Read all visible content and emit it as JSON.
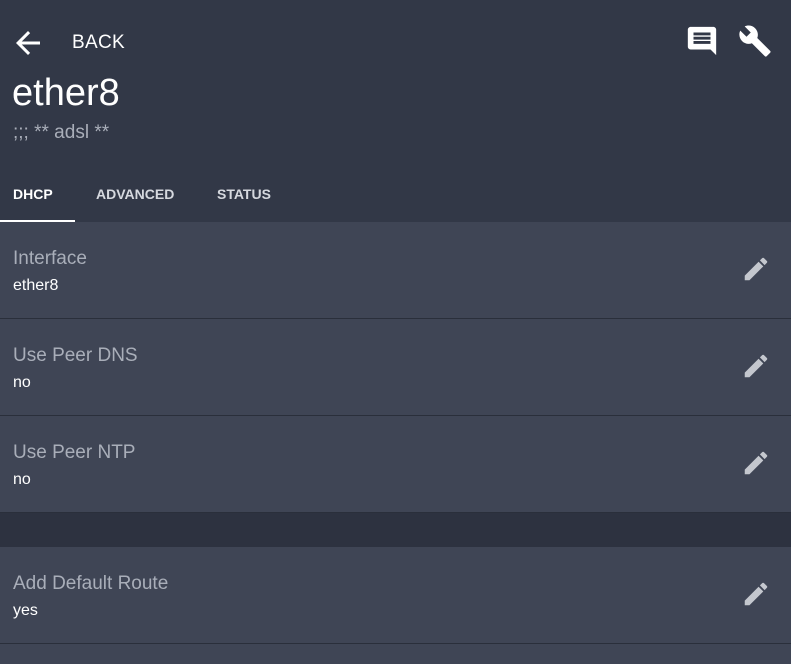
{
  "header": {
    "back_label": "BACK",
    "title": "ether8",
    "subtitle": ";;; ** adsl **",
    "icons": [
      "arrow-left-icon",
      "comment-icon",
      "wrench-icon"
    ]
  },
  "tabs": [
    {
      "label": "DHCP",
      "active": true
    },
    {
      "label": "ADVANCED",
      "active": false
    },
    {
      "label": "STATUS",
      "active": false
    }
  ],
  "settings": [
    {
      "label": "Interface",
      "value": "ether8"
    },
    {
      "label": "Use Peer DNS",
      "value": "no"
    },
    {
      "label": "Use Peer NTP",
      "value": "no"
    },
    {
      "label": "Add Default Route",
      "value": "yes"
    }
  ],
  "colors": {
    "header_bg": "#323847",
    "row_bg": "#3f4555",
    "page_bg": "#2d3240",
    "label_text": "#a9aeb9",
    "value_text": "#ffffff",
    "icon": "#c4c7ce"
  }
}
